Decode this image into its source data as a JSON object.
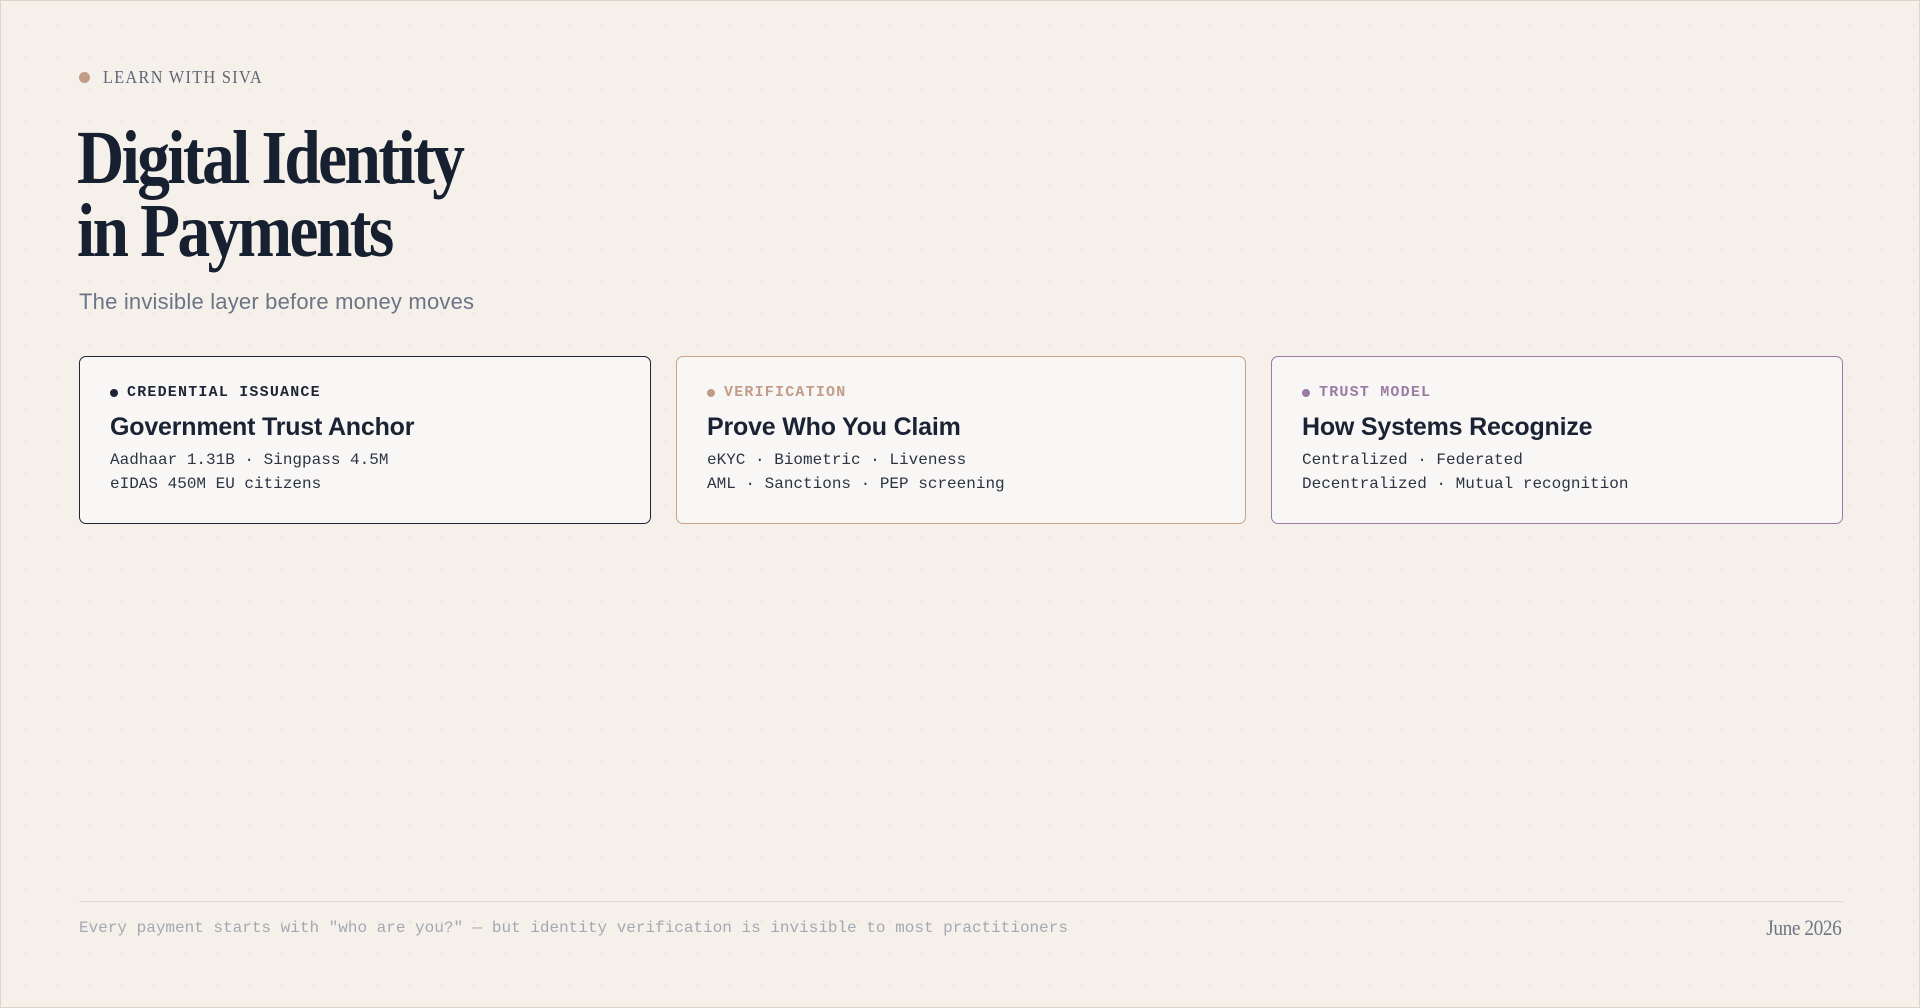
{
  "kicker": {
    "label": "LEARN WITH SIVA",
    "dot_color": "#c29c88"
  },
  "title": {
    "line1": "Digital Identity",
    "line2": "in Payments"
  },
  "subtitle": "The invisible layer before money moves",
  "cards": [
    {
      "tag": "CREDENTIAL ISSUANCE",
      "accent_color": "#1d2536",
      "title": "Government Trust Anchor",
      "line1": "Aadhaar 1.31B · Singpass 4.5M",
      "line2": "eIDAS 450M EU citizens"
    },
    {
      "tag": "VERIFICATION",
      "accent_color": "#c29c88",
      "title": "Prove Who You Claim",
      "line1": "eKYC · Biometric · Liveness",
      "line2": "AML · Sanctions · PEP screening"
    },
    {
      "tag": "TRUST MODEL",
      "accent_color": "#9a7ba5",
      "title": "How Systems Recognize",
      "line1": "Centralized · Federated",
      "line2": "Decentralized · Mutual recognition"
    }
  ],
  "footer": {
    "note": "Every payment starts with \"who are you?\" — but identity verification is invisible to most practitioners",
    "date": "June 2026"
  }
}
